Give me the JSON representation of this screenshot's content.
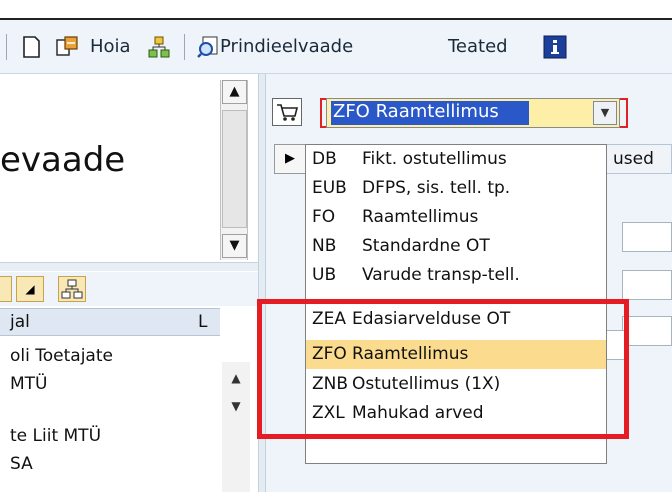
{
  "toolbar": {
    "hold_label": "Hoia",
    "print_preview_label": "Prindieelvaade",
    "messages_label": "Teated"
  },
  "left": {
    "title": "evaade",
    "table": {
      "col1": "jal",
      "col2": "L",
      "rows": [
        "oli Toetajate",
        "MTÜ",
        "te Liit MTÜ",
        "SA"
      ]
    }
  },
  "combo": {
    "value": "ZFO Raamtellimus"
  },
  "tab_right_label": "used",
  "dropdown": {
    "options": [
      {
        "code": "DB",
        "desc": "Fikt. ostutellimus"
      },
      {
        "code": "EUB",
        "desc": "DFPS, sis. tell. tp."
      },
      {
        "code": "FO",
        "desc": "Raamtellimus"
      },
      {
        "code": "NB",
        "desc": "Standardne OT"
      },
      {
        "code": "UB",
        "desc": "Varude transp-tell."
      },
      {
        "code": "ZEA",
        "desc": "Edasiarvelduse OT"
      },
      {
        "code": "ZFO",
        "desc": "Raamtellimus"
      },
      {
        "code": "ZNB",
        "desc": "Ostutellimus (1X)"
      },
      {
        "code": "ZXL",
        "desc": "Mahukad arved"
      }
    ],
    "selected_index": 6
  },
  "colors": {
    "highlight": "#e51c23",
    "selected_option": "#fbdc8e",
    "combo_selection": "#2a58c8"
  }
}
